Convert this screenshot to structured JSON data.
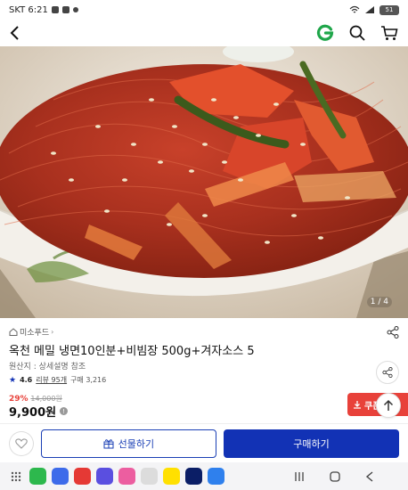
{
  "status_bar": {
    "time": "SKT 6:21",
    "battery": "51"
  },
  "image": {
    "counter": "1 / 4"
  },
  "product": {
    "brand": "미소푸드",
    "title": "옥천 메밀 냉면10인분+비빔장 500g+겨자소스 5",
    "origin": "원산지 : 상세설명 참조",
    "rating": "4.6",
    "reviews": "리뷰 95개",
    "purchases": "구매 3,216",
    "discount": "29%",
    "original_price": "14,000원",
    "price": "9,900원",
    "coupon_label": "쿠폰"
  },
  "actions": {
    "gift_label": "선물하기",
    "buy_label": "구매하기"
  },
  "colors": {
    "accent": "#1232b5",
    "sale": "#e8413a",
    "g_logo": "#1fa64a"
  }
}
